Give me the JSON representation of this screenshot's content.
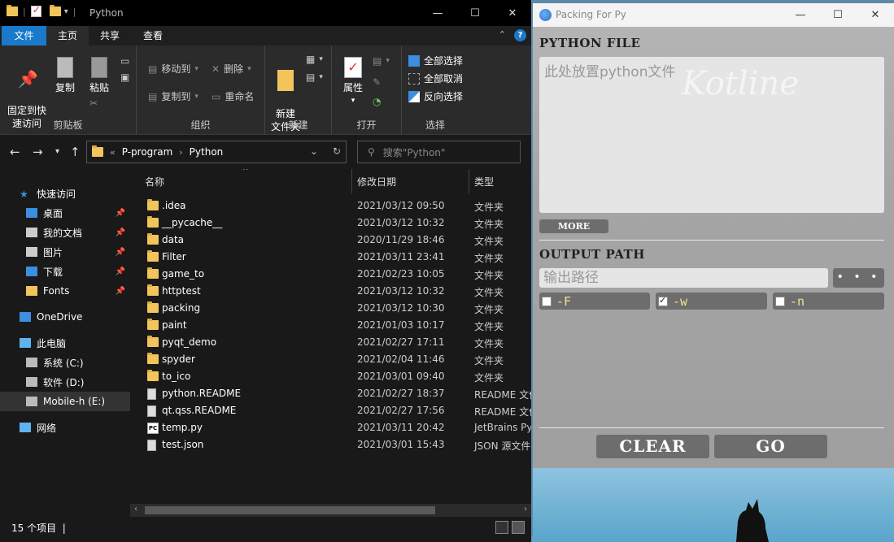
{
  "explorer": {
    "title": "Python",
    "tabs": {
      "file": "文件",
      "home": "主页",
      "share": "共享",
      "view": "查看"
    },
    "ribbon": {
      "clipboard": {
        "label": "剪贴板",
        "pin": "固定到快\n速访问",
        "copy": "复制",
        "paste": "粘贴"
      },
      "organize": {
        "label": "组织",
        "move_to": "移动到",
        "copy_to": "复制到",
        "delete": "删除",
        "rename": "重命名"
      },
      "new": {
        "label": "新建",
        "new_folder": "新建\n文件夹"
      },
      "open": {
        "label": "打开",
        "properties": "属性"
      },
      "select": {
        "label": "选择",
        "select_all": "全部选择",
        "select_none": "全部取消",
        "invert": "反向选择"
      }
    },
    "address": {
      "prefix": "«",
      "crumbs": [
        "P-program",
        "Python"
      ]
    },
    "search_placeholder": "搜索\"Python\"",
    "nav": [
      {
        "label": "快速访问",
        "icon": "star-icon"
      },
      {
        "label": "桌面",
        "icon": "desktop-icon",
        "pinned": true
      },
      {
        "label": "我的文档",
        "icon": "documents-icon",
        "pinned": true
      },
      {
        "label": "图片",
        "icon": "pictures-icon",
        "pinned": true
      },
      {
        "label": "下载",
        "icon": "download-icon",
        "pinned": true
      },
      {
        "label": "Fonts",
        "icon": "fonts-folder-icon",
        "pinned": true
      },
      {
        "label": "OneDrive",
        "icon": "cloud-icon"
      },
      {
        "label": "此电脑",
        "icon": "computer-icon"
      },
      {
        "label": "系统 (C:)",
        "icon": "drive-icon"
      },
      {
        "label": "软件 (D:)",
        "icon": "drive-icon"
      },
      {
        "label": "Mobile-h (E:)",
        "icon": "drive-icon"
      },
      {
        "label": "网络",
        "icon": "network-icon"
      }
    ],
    "columns": {
      "name": "名称",
      "date": "修改日期",
      "type": "类型"
    },
    "files": [
      {
        "name": ".idea",
        "date": "2021/03/12 09:50",
        "type": "文件夹",
        "kind": "folder"
      },
      {
        "name": "__pycache__",
        "date": "2021/03/12 10:32",
        "type": "文件夹",
        "kind": "folder"
      },
      {
        "name": "data",
        "date": "2020/11/29 18:46",
        "type": "文件夹",
        "kind": "folder"
      },
      {
        "name": "Filter",
        "date": "2021/03/11 23:41",
        "type": "文件夹",
        "kind": "folder"
      },
      {
        "name": "game_to",
        "date": "2021/02/23 10:05",
        "type": "文件夹",
        "kind": "folder"
      },
      {
        "name": "httptest",
        "date": "2021/03/12 10:32",
        "type": "文件夹",
        "kind": "folder"
      },
      {
        "name": "packing",
        "date": "2021/03/12 10:30",
        "type": "文件夹",
        "kind": "folder"
      },
      {
        "name": "paint",
        "date": "2021/01/03 10:17",
        "type": "文件夹",
        "kind": "folder"
      },
      {
        "name": "pyqt_demo",
        "date": "2021/02/27 17:11",
        "type": "文件夹",
        "kind": "folder"
      },
      {
        "name": "spyder",
        "date": "2021/02/04 11:46",
        "type": "文件夹",
        "kind": "folder"
      },
      {
        "name": "to_ico",
        "date": "2021/03/01 09:40",
        "type": "文件夹",
        "kind": "folder"
      },
      {
        "name": "python.README",
        "date": "2021/02/27 18:37",
        "type": "README 文件",
        "kind": "file"
      },
      {
        "name": "qt.qss.README",
        "date": "2021/02/27 17:56",
        "type": "README 文件",
        "kind": "file"
      },
      {
        "name": "temp.py",
        "date": "2021/03/11 20:42",
        "type": "JetBrains PyCharm",
        "kind": "py"
      },
      {
        "name": "test.json",
        "date": "2021/03/01 15:43",
        "type": "JSON 源文件",
        "kind": "file"
      }
    ],
    "status": "15 个项目"
  },
  "packer": {
    "title": "Packing For Py",
    "python_file_heading": "PYTHON FILE",
    "dropzone_placeholder": "此处放置python文件",
    "watermark": "Kotline",
    "more_label": "MORE",
    "output_heading": "OUTPUT PATH",
    "output_placeholder": "输出路径",
    "browse_label": "• • •",
    "options": [
      {
        "label": "-F",
        "checked": false
      },
      {
        "label": "-w",
        "checked": true
      },
      {
        "label": "-n",
        "checked": false
      }
    ],
    "clear_label": "CLEAR",
    "go_label": "GO"
  }
}
